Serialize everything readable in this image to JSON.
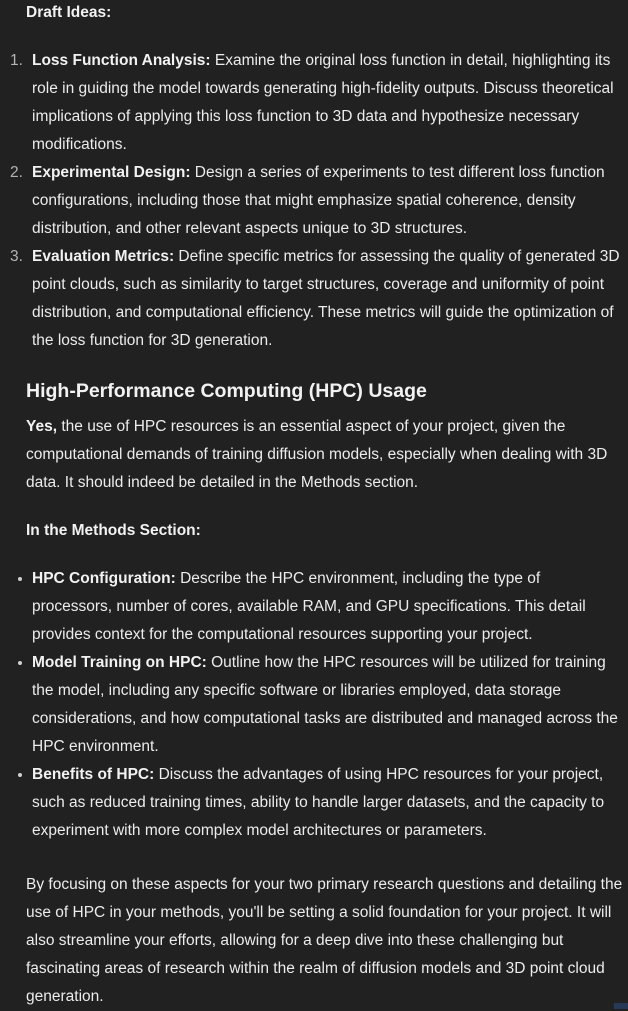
{
  "draft_heading": "Draft Ideas:",
  "draft_items": [
    {
      "marker": "1.",
      "title": "Loss Function Analysis:",
      "text": " Examine the original loss function in detail, highlighting its role in guiding the model towards generating high-fidelity outputs. Discuss theoretical implications of applying this loss function to 3D data and hypothesize necessary modifications."
    },
    {
      "marker": "2.",
      "title": "Experimental Design:",
      "text": " Design a series of experiments to test different loss function configurations, including those that might emphasize spatial coherence, density distribution, and other relevant aspects unique to 3D structures."
    },
    {
      "marker": "3.",
      "title": "Evaluation Metrics:",
      "text": " Define specific metrics for assessing the quality of generated 3D point clouds, such as similarity to target structures, coverage and uniformity of point distribution, and computational efficiency. These metrics will guide the optimization of the loss function for 3D generation."
    }
  ],
  "hpc_heading": "High-Performance Computing (HPC) Usage",
  "hpc_intro": {
    "bold": "Yes,",
    "text": " the use of HPC resources is an essential aspect of your project, given the computational demands of training diffusion models, especially when dealing with 3D data. It should indeed be detailed in the Methods section."
  },
  "methods_heading": "In the Methods Section:",
  "methods_items": [
    {
      "title": "HPC Configuration:",
      "text": " Describe the HPC environment, including the type of processors, number of cores, available RAM, and GPU specifications. This detail provides context for the computational resources supporting your project."
    },
    {
      "title": "Model Training on HPC:",
      "text": " Outline how the HPC resources will be utilized for training the model, including any specific software or libraries employed, data storage considerations, and how computational tasks are distributed and managed across the HPC environment."
    },
    {
      "title": "Benefits of HPC:",
      "text": " Discuss the advantages of using HPC resources for your project, such as reduced training times, ability to handle larger datasets, and the capacity to experiment with more complex model architectures or parameters."
    }
  ],
  "closing": "By focusing on these aspects for your two primary research questions and detailing the use of HPC in your methods, you'll be setting a solid foundation for your project. It will also streamline your efforts, allowing for a deep dive into these challenging but fascinating areas of research within the realm of diffusion models and 3D point cloud generation."
}
